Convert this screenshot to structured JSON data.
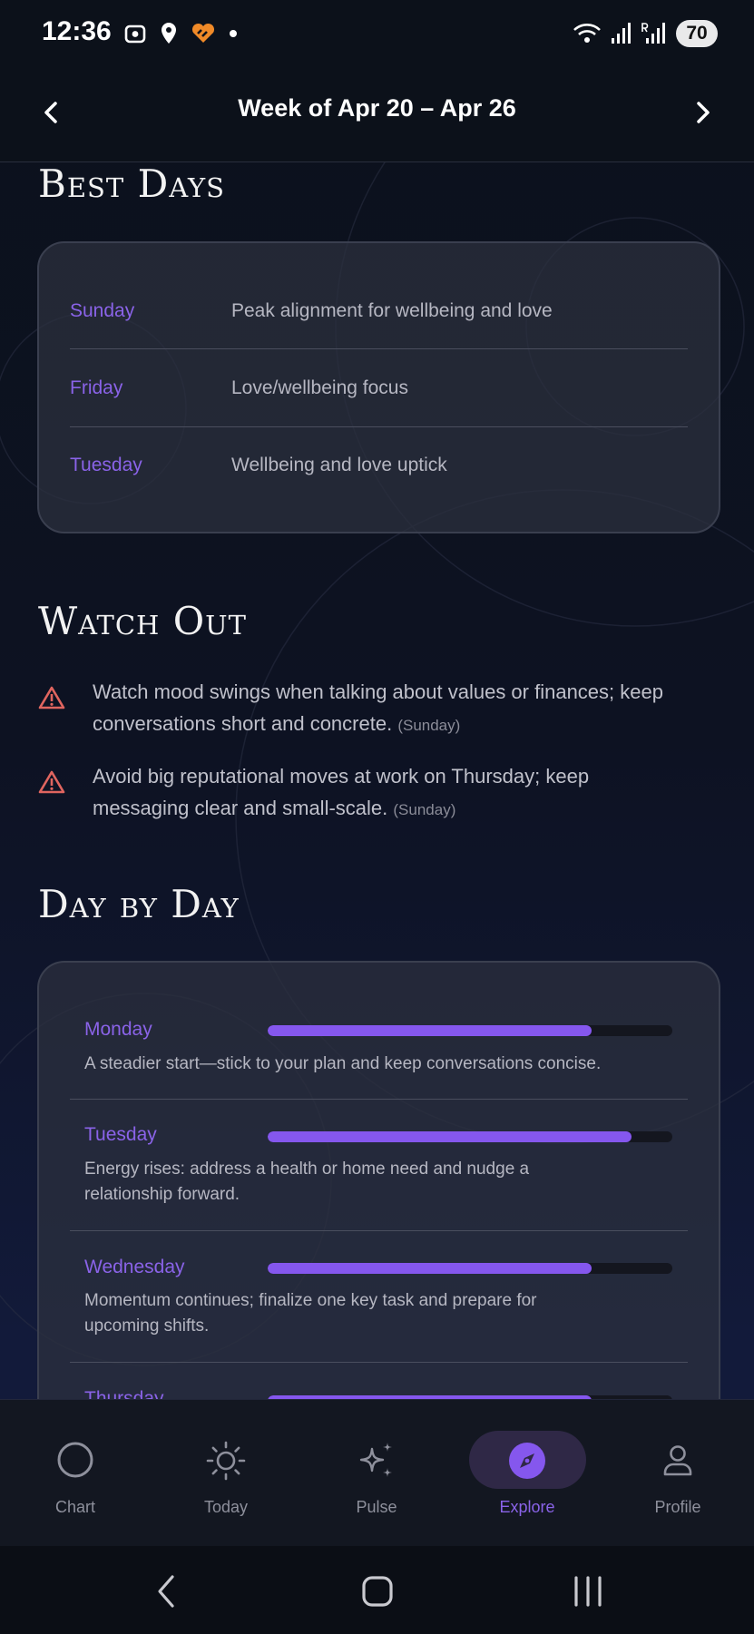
{
  "status": {
    "time": "12:36",
    "battery": "70"
  },
  "header": {
    "title": "Week of Apr 20 – Apr 26"
  },
  "best_days": {
    "title": "Best Days",
    "items": [
      {
        "day": "Sunday",
        "desc": "Peak alignment for wellbeing and love"
      },
      {
        "day": "Friday",
        "desc": "Love/wellbeing focus"
      },
      {
        "day": "Tuesday",
        "desc": "Wellbeing and love uptick"
      }
    ]
  },
  "watch_out": {
    "title": "Watch Out",
    "items": [
      {
        "line1": "Watch mood swings when talking about values or finances; keep",
        "line2": "conversations short and concrete.",
        "source": "(Sunday)"
      },
      {
        "line1": "Avoid big reputational moves at work on Thursday; keep",
        "line2": "messaging clear and small-scale.",
        "source": "(Sunday)"
      }
    ]
  },
  "day_by_day": {
    "title": "Day by Day",
    "items": [
      {
        "day": "Monday",
        "level": 0.8,
        "line1": "A steadier start—stick to your plan and keep conversations concise.",
        "line2": ""
      },
      {
        "day": "Tuesday",
        "level": 0.9,
        "line1": "Energy rises: address a health or home need and nudge a",
        "line2": "relationship forward."
      },
      {
        "day": "Wednesday",
        "level": 0.8,
        "line1": "Momentum continues; finalize one key task and prepare for",
        "line2": "upcoming shifts."
      },
      {
        "day": "Thursday",
        "level": 0.8,
        "line1": "",
        "line2": ""
      }
    ]
  },
  "tabs": [
    {
      "label": "Chart",
      "icon": "circle-icon"
    },
    {
      "label": "Today",
      "icon": "sun-icon"
    },
    {
      "label": "Pulse",
      "icon": "sparkle-icon"
    },
    {
      "label": "Explore",
      "icon": "compass-icon",
      "active": true
    },
    {
      "label": "Profile",
      "icon": "person-icon"
    }
  ],
  "colors": {
    "accent": "#8557ee",
    "accent_text": "#8a63e8",
    "warning": "#e0655f"
  }
}
